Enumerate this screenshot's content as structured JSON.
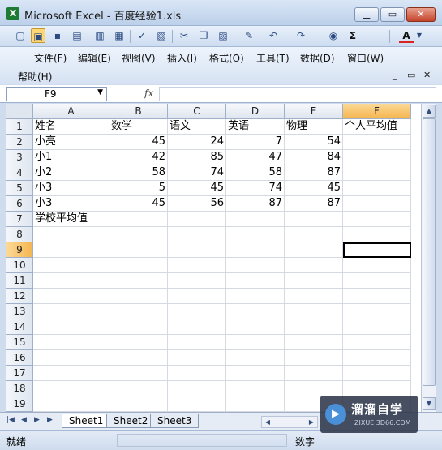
{
  "window": {
    "title": "Microsoft Excel - 百度经验1.xls",
    "app_icon": "X"
  },
  "toolbar": {
    "icons": [
      "new-icon",
      "open-icon",
      "save-icon",
      "permission-icon",
      "print-icon",
      "print-preview-icon",
      "spelling-icon",
      "research-icon",
      "cut-icon",
      "copy-icon",
      "paste-icon",
      "format-painter-icon",
      "undo-icon",
      "redo-icon",
      "hyperlink-icon",
      "autosum-icon",
      "font-color-icon"
    ],
    "autosum_glyph": "Σ",
    "font_color_glyph": "A"
  },
  "menu": {
    "items": [
      "文件(F)",
      "编辑(E)",
      "视图(V)",
      "插入(I)",
      "格式(O)",
      "工具(T)",
      "数据(D)",
      "窗口(W)"
    ],
    "help": "帮助(H)"
  },
  "formula_bar": {
    "name_box": "F9",
    "fx": "fx",
    "value": ""
  },
  "grid": {
    "columns": [
      "A",
      "B",
      "C",
      "D",
      "E",
      "F"
    ],
    "selected_column": "F",
    "rows": [
      "1",
      "2",
      "3",
      "4",
      "5",
      "6",
      "7",
      "8",
      "9",
      "10",
      "11",
      "12",
      "13",
      "14",
      "15",
      "16",
      "17",
      "18",
      "19"
    ],
    "selected_row": "9",
    "cells": [
      [
        "姓名",
        "数学",
        "语文",
        "英语",
        "物理",
        "个人平均值"
      ],
      [
        "小亮",
        "45",
        "24",
        "7",
        "54",
        ""
      ],
      [
        "小1",
        "42",
        "85",
        "47",
        "84",
        ""
      ],
      [
        "小2",
        "58",
        "74",
        "58",
        "87",
        ""
      ],
      [
        "小3",
        "5",
        "45",
        "74",
        "45",
        ""
      ],
      [
        "小3",
        "45",
        "56",
        "87",
        "87",
        ""
      ],
      [
        "学校平均值",
        "",
        "",
        "",
        "",
        ""
      ]
    ]
  },
  "sheets": {
    "tabs": [
      "Sheet1",
      "Sheet2",
      "Sheet3"
    ],
    "active": "Sheet1"
  },
  "status": {
    "left": "就绪",
    "mode": "数字"
  },
  "watermark": {
    "text": "溜溜自学",
    "sub": "ZIXUE.3D66.COM"
  }
}
